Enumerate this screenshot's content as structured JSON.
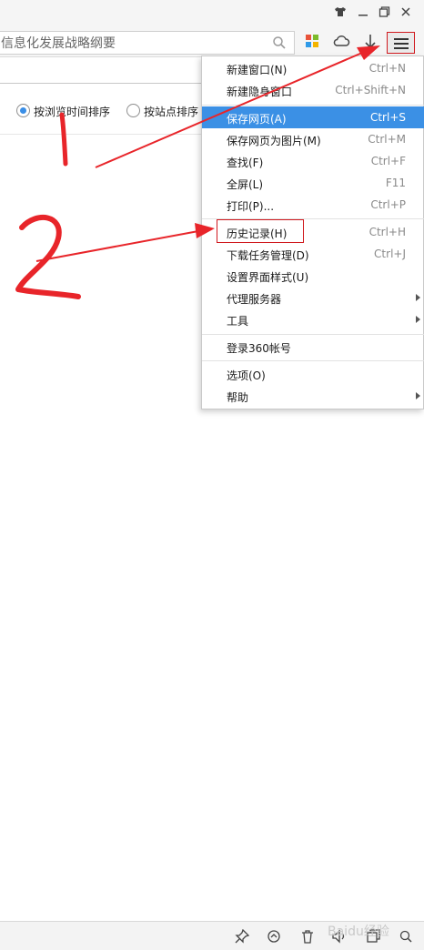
{
  "toolbar": {
    "address_value": "信息化发展战略纲要"
  },
  "sort": {
    "option_time": "按浏览时间排序",
    "option_site": "按站点排序"
  },
  "menu": {
    "items": [
      {
        "label": "新建窗口(N)",
        "shortcut": "Ctrl+N"
      },
      {
        "label": "新建隐身窗口",
        "shortcut": "Ctrl+Shift+N"
      },
      {
        "label": "保存网页(A)",
        "shortcut": "Ctrl+S"
      },
      {
        "label": "保存网页为图片(M)",
        "shortcut": "Ctrl+M"
      },
      {
        "label": "查找(F)",
        "shortcut": "Ctrl+F"
      },
      {
        "label": "全屏(L)",
        "shortcut": "F11"
      },
      {
        "label": "打印(P)...",
        "shortcut": "Ctrl+P"
      },
      {
        "label": "历史记录(H)",
        "shortcut": "Ctrl+H"
      },
      {
        "label": "下载任务管理(D)",
        "shortcut": "Ctrl+J"
      },
      {
        "label": "设置界面样式(U)",
        "shortcut": ""
      },
      {
        "label": "代理服务器",
        "shortcut": ""
      },
      {
        "label": "工具",
        "shortcut": ""
      },
      {
        "label": "登录360帐号",
        "shortcut": ""
      },
      {
        "label": "选项(O)",
        "shortcut": ""
      },
      {
        "label": "帮助",
        "shortcut": ""
      }
    ],
    "active_index": 2,
    "highlighted_item": "历史记录(H)"
  },
  "annotations": {
    "step1": "1",
    "step2": "2",
    "color": "#e8252a"
  },
  "watermark": "Baidu经验",
  "colors": {
    "accent": "#3b90e5",
    "annotation_red": "#e8252a"
  },
  "icons": [
    "shirt-icon",
    "minimize-icon",
    "restore-icon",
    "close-icon",
    "search-icon",
    "apps-icon",
    "cloud-icon",
    "download-icon",
    "menu-icon",
    "pin-icon",
    "refresh-icon",
    "trash-icon",
    "volume-icon",
    "window-icon",
    "zoom-icon"
  ]
}
